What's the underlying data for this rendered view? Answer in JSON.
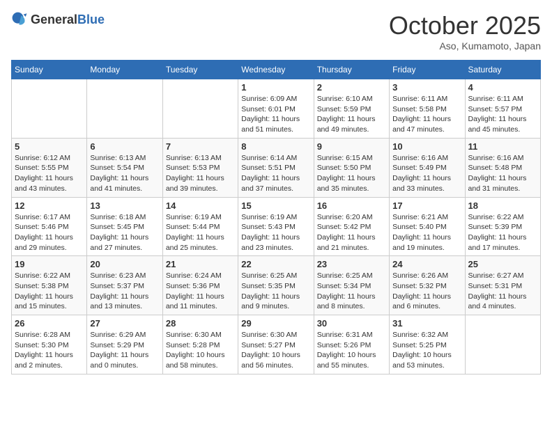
{
  "header": {
    "logo_general": "General",
    "logo_blue": "Blue",
    "month": "October 2025",
    "location": "Aso, Kumamoto, Japan"
  },
  "days_of_week": [
    "Sunday",
    "Monday",
    "Tuesday",
    "Wednesday",
    "Thursday",
    "Friday",
    "Saturday"
  ],
  "weeks": [
    [
      {
        "day": "",
        "info": ""
      },
      {
        "day": "",
        "info": ""
      },
      {
        "day": "",
        "info": ""
      },
      {
        "day": "1",
        "info": "Sunrise: 6:09 AM\nSunset: 6:01 PM\nDaylight: 11 hours\nand 51 minutes."
      },
      {
        "day": "2",
        "info": "Sunrise: 6:10 AM\nSunset: 5:59 PM\nDaylight: 11 hours\nand 49 minutes."
      },
      {
        "day": "3",
        "info": "Sunrise: 6:11 AM\nSunset: 5:58 PM\nDaylight: 11 hours\nand 47 minutes."
      },
      {
        "day": "4",
        "info": "Sunrise: 6:11 AM\nSunset: 5:57 PM\nDaylight: 11 hours\nand 45 minutes."
      }
    ],
    [
      {
        "day": "5",
        "info": "Sunrise: 6:12 AM\nSunset: 5:55 PM\nDaylight: 11 hours\nand 43 minutes."
      },
      {
        "day": "6",
        "info": "Sunrise: 6:13 AM\nSunset: 5:54 PM\nDaylight: 11 hours\nand 41 minutes."
      },
      {
        "day": "7",
        "info": "Sunrise: 6:13 AM\nSunset: 5:53 PM\nDaylight: 11 hours\nand 39 minutes."
      },
      {
        "day": "8",
        "info": "Sunrise: 6:14 AM\nSunset: 5:51 PM\nDaylight: 11 hours\nand 37 minutes."
      },
      {
        "day": "9",
        "info": "Sunrise: 6:15 AM\nSunset: 5:50 PM\nDaylight: 11 hours\nand 35 minutes."
      },
      {
        "day": "10",
        "info": "Sunrise: 6:16 AM\nSunset: 5:49 PM\nDaylight: 11 hours\nand 33 minutes."
      },
      {
        "day": "11",
        "info": "Sunrise: 6:16 AM\nSunset: 5:48 PM\nDaylight: 11 hours\nand 31 minutes."
      }
    ],
    [
      {
        "day": "12",
        "info": "Sunrise: 6:17 AM\nSunset: 5:46 PM\nDaylight: 11 hours\nand 29 minutes."
      },
      {
        "day": "13",
        "info": "Sunrise: 6:18 AM\nSunset: 5:45 PM\nDaylight: 11 hours\nand 27 minutes."
      },
      {
        "day": "14",
        "info": "Sunrise: 6:19 AM\nSunset: 5:44 PM\nDaylight: 11 hours\nand 25 minutes."
      },
      {
        "day": "15",
        "info": "Sunrise: 6:19 AM\nSunset: 5:43 PM\nDaylight: 11 hours\nand 23 minutes."
      },
      {
        "day": "16",
        "info": "Sunrise: 6:20 AM\nSunset: 5:42 PM\nDaylight: 11 hours\nand 21 minutes."
      },
      {
        "day": "17",
        "info": "Sunrise: 6:21 AM\nSunset: 5:40 PM\nDaylight: 11 hours\nand 19 minutes."
      },
      {
        "day": "18",
        "info": "Sunrise: 6:22 AM\nSunset: 5:39 PM\nDaylight: 11 hours\nand 17 minutes."
      }
    ],
    [
      {
        "day": "19",
        "info": "Sunrise: 6:22 AM\nSunset: 5:38 PM\nDaylight: 11 hours\nand 15 minutes."
      },
      {
        "day": "20",
        "info": "Sunrise: 6:23 AM\nSunset: 5:37 PM\nDaylight: 11 hours\nand 13 minutes."
      },
      {
        "day": "21",
        "info": "Sunrise: 6:24 AM\nSunset: 5:36 PM\nDaylight: 11 hours\nand 11 minutes."
      },
      {
        "day": "22",
        "info": "Sunrise: 6:25 AM\nSunset: 5:35 PM\nDaylight: 11 hours\nand 9 minutes."
      },
      {
        "day": "23",
        "info": "Sunrise: 6:25 AM\nSunset: 5:34 PM\nDaylight: 11 hours\nand 8 minutes."
      },
      {
        "day": "24",
        "info": "Sunrise: 6:26 AM\nSunset: 5:32 PM\nDaylight: 11 hours\nand 6 minutes."
      },
      {
        "day": "25",
        "info": "Sunrise: 6:27 AM\nSunset: 5:31 PM\nDaylight: 11 hours\nand 4 minutes."
      }
    ],
    [
      {
        "day": "26",
        "info": "Sunrise: 6:28 AM\nSunset: 5:30 PM\nDaylight: 11 hours\nand 2 minutes."
      },
      {
        "day": "27",
        "info": "Sunrise: 6:29 AM\nSunset: 5:29 PM\nDaylight: 11 hours\nand 0 minutes."
      },
      {
        "day": "28",
        "info": "Sunrise: 6:30 AM\nSunset: 5:28 PM\nDaylight: 10 hours\nand 58 minutes."
      },
      {
        "day": "29",
        "info": "Sunrise: 6:30 AM\nSunset: 5:27 PM\nDaylight: 10 hours\nand 56 minutes."
      },
      {
        "day": "30",
        "info": "Sunrise: 6:31 AM\nSunset: 5:26 PM\nDaylight: 10 hours\nand 55 minutes."
      },
      {
        "day": "31",
        "info": "Sunrise: 6:32 AM\nSunset: 5:25 PM\nDaylight: 10 hours\nand 53 minutes."
      },
      {
        "day": "",
        "info": ""
      }
    ]
  ]
}
